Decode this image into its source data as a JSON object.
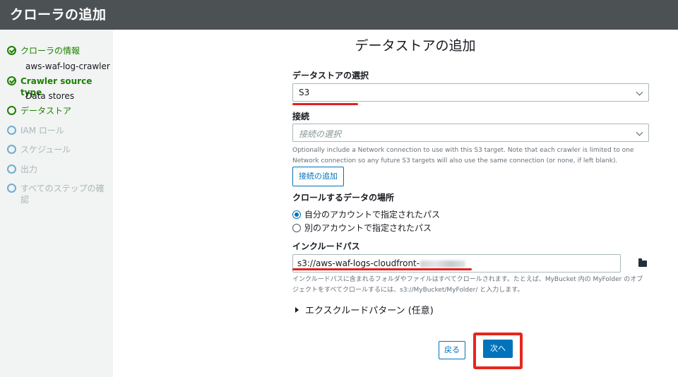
{
  "header": {
    "title": "クローラの追加"
  },
  "sidebar": {
    "steps": [
      {
        "label": "クローラの情報",
        "sub": "aws-waf-log-crawler",
        "state": "done"
      },
      {
        "label": "Crawler source type",
        "sub": "Data stores",
        "state": "done"
      },
      {
        "label": "データストア",
        "state": "active"
      },
      {
        "label": "IAM ロール",
        "state": "pending"
      },
      {
        "label": "スケジュール",
        "state": "pending"
      },
      {
        "label": "出力",
        "state": "pending"
      },
      {
        "label": "すべてのステップの確認",
        "state": "pending"
      }
    ]
  },
  "main": {
    "title": "データストアの追加",
    "datastore": {
      "label": "データストアの選択",
      "value": "S3"
    },
    "connection": {
      "label": "接続",
      "placeholder": "接続の選択",
      "help": "Optionally include a Network connection to use with this S3 target. Note that each crawler is limited to one Network connection so any future S3 targets will also use the same connection (or none, if left blank).",
      "add_button": "接続の追加"
    },
    "location": {
      "label": "クロールするデータの場所",
      "options": [
        {
          "label": "自分のアカウントで指定されたパス",
          "selected": true
        },
        {
          "label": "別のアカウントで指定されたパス",
          "selected": false
        }
      ]
    },
    "include_path": {
      "label": "インクルードパス",
      "value": "s3://aws-waf-logs-cloudfront-",
      "help": "インクルードパスに含まれるフォルダやファイルはすべてクロールされます。たとえば、MyBucket 内の MyFolder のオブジェクトをすべてクロールするには、s3://MyBucket/MyFolder/ と入力します。",
      "browse_icon": "folder-icon"
    },
    "exclude": {
      "label": "エクスクルードパターン (任意)"
    },
    "buttons": {
      "back": "戻る",
      "next": "次へ"
    }
  },
  "colors": {
    "header_bg": "#4c5253",
    "success": "#1d8102",
    "primary": "#0073bb",
    "annotation_red": "#e02020"
  }
}
